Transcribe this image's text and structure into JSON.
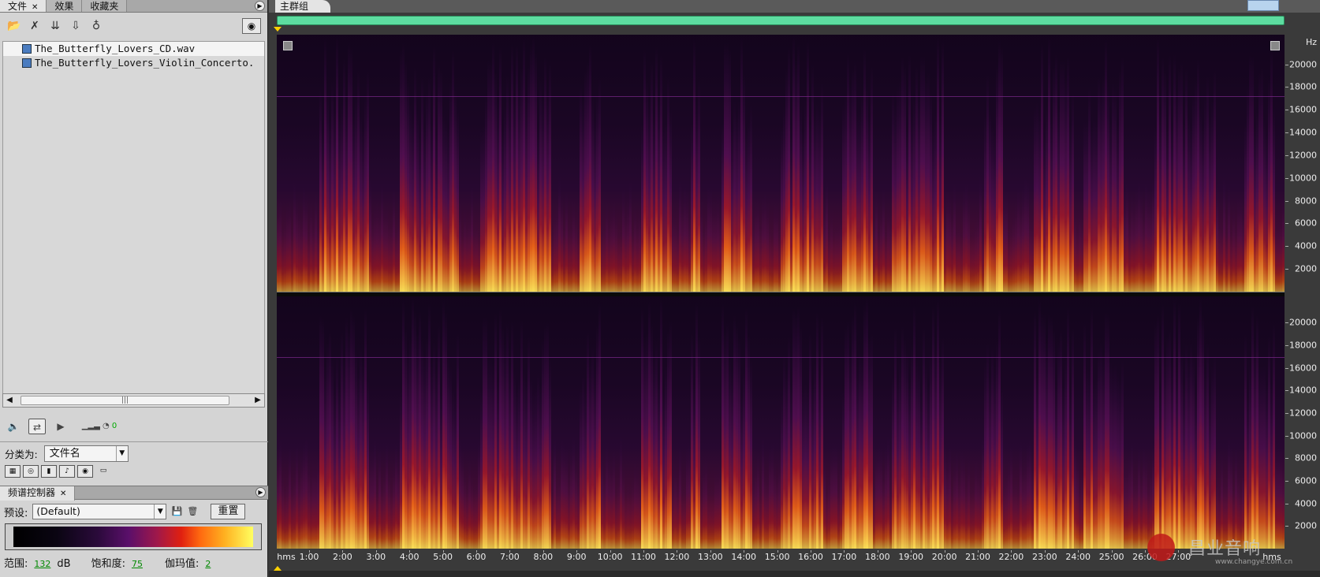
{
  "left_panel": {
    "tabs": [
      {
        "label": "文件",
        "active": true,
        "closable": true
      },
      {
        "label": "效果",
        "active": false,
        "closable": false
      },
      {
        "label": "收藏夹",
        "active": false,
        "closable": false
      }
    ],
    "files": [
      {
        "name": "The_Butterfly_Lovers_CD.wav",
        "selected": true
      },
      {
        "name": "The_Butterfly_Lovers_Violin_Concerto.",
        "selected": false
      }
    ],
    "scroll_thumb": "|||",
    "volume_value": "0",
    "sort_label": "分类为:",
    "sort_value": "文件名"
  },
  "spectral_panel": {
    "tab_label": "频谱控制器",
    "preset_label": "预设:",
    "preset_value": "(Default)",
    "reset_label": "重置",
    "range_label": "范围:",
    "range_value": "132",
    "range_unit": "dB",
    "saturation_label": "饱和度:",
    "saturation_value": "75",
    "gamma_label": "伽玛值:",
    "gamma_value": "2"
  },
  "main": {
    "tab_label": "主群组",
    "hz_unit": "Hz",
    "hz_labels_ch1": [
      "20000",
      "18000",
      "16000",
      "14000",
      "12000",
      "10000",
      "8000",
      "6000",
      "4000",
      "2000"
    ],
    "hz_labels_ch2": [
      "20000",
      "18000",
      "16000",
      "14000",
      "12000",
      "10000",
      "8000",
      "6000",
      "4000",
      "2000"
    ],
    "time_start": "hms",
    "time_end": "hms",
    "time_labels": [
      "1:00",
      "2:00",
      "3:00",
      "4:00",
      "5:00",
      "6:00",
      "7:00",
      "8:00",
      "9:00",
      "10:00",
      "11:00",
      "12:00",
      "13:00",
      "14:00",
      "15:00",
      "16:00",
      "17:00",
      "18:00",
      "19:00",
      "20:00",
      "21:00",
      "22:00",
      "23:00",
      "24:00",
      "25:00",
      "26:00",
      "27:00"
    ],
    "watermark_text": "昌业音响",
    "watermark_url": "www.changye.com.cn",
    "colors": {
      "overview": "#5ddca0",
      "playhead": "#ffd000"
    }
  }
}
